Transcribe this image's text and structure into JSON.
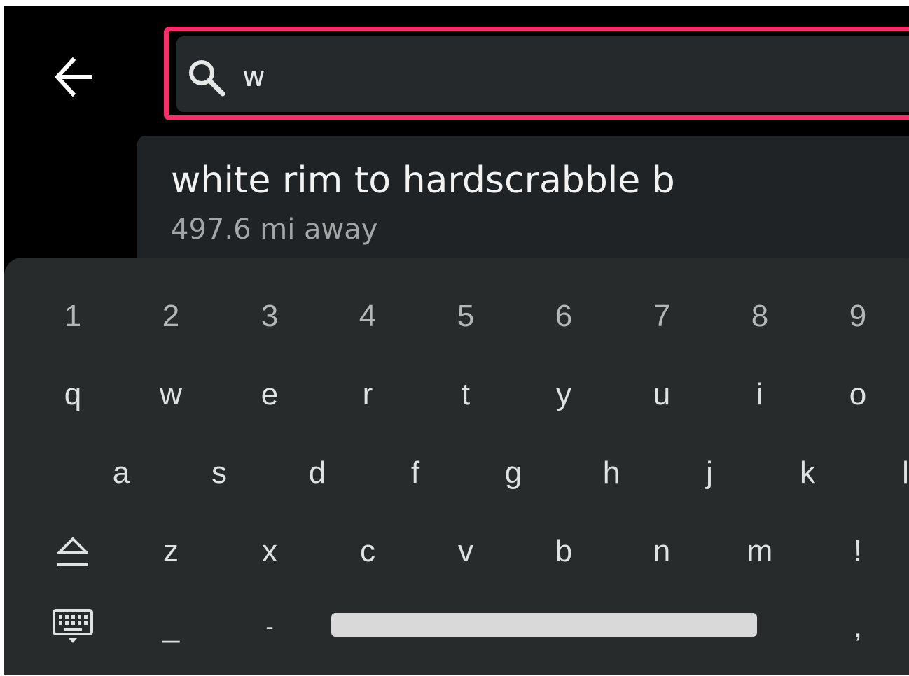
{
  "search": {
    "value": "w",
    "highlight_color": "#f4306b"
  },
  "suggestion": {
    "title": "white rim to hardscrabble b",
    "distance": "497.6 mi away"
  },
  "keyboard": {
    "numbers": [
      "1",
      "2",
      "3",
      "4",
      "5",
      "6",
      "7",
      "8",
      "9"
    ],
    "row1": [
      "q",
      "w",
      "e",
      "r",
      "t",
      "y",
      "u",
      "i",
      "o"
    ],
    "row2": [
      "a",
      "s",
      "d",
      "f",
      "g",
      "h",
      "j",
      "k",
      "l"
    ],
    "row3": [
      "z",
      "x",
      "c",
      "v",
      "b",
      "n",
      "m",
      "!"
    ],
    "row4": [
      "_",
      "-",
      ","
    ]
  },
  "icons": {
    "back": "back-arrow-icon",
    "search": "search-icon",
    "shift": "shift-icon",
    "keyboard": "keyboard-icon"
  }
}
